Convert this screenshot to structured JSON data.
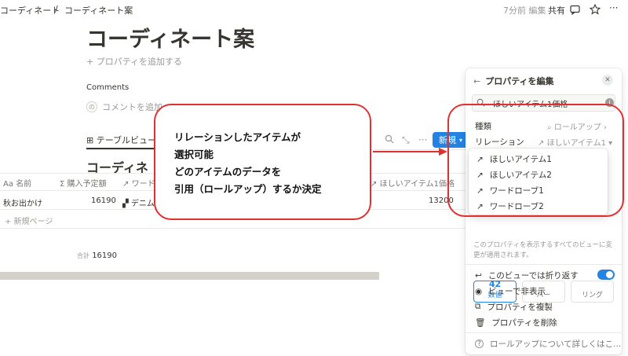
{
  "breadcrumb": {
    "parent": "コーディネート",
    "separator": "/",
    "current": "コーディネート案"
  },
  "topbar": {
    "edited": "7分前 編集",
    "share": "共有"
  },
  "page": {
    "title": "コーディネート案",
    "add_property": "+ プロパティを追加する"
  },
  "comments": {
    "heading": "Comments",
    "avatar": "の",
    "placeholder": "コメントを追加"
  },
  "database": {
    "view_tab": "テーブルビュー",
    "title": "コーディネ",
    "new_button": "新規",
    "columns": [
      "名前",
      "購入予定額",
      "ワード",
      "ほしいアイテム1価格"
    ],
    "column_prefixes": [
      "Aa",
      "Σ",
      "↗",
      "↗"
    ],
    "row": {
      "name": "秋お出かけ",
      "amount": "16190",
      "relation": "デニム",
      "price": "13200"
    },
    "new_page": "+ 新規ページ",
    "total_label": "合計",
    "total_value": "16190"
  },
  "callout": {
    "lines": [
      "リレーションしたアイテムが",
      "選択可能",
      "どのアイテムのデータを",
      "引用（ロールアップ）するか決定"
    ]
  },
  "panel": {
    "title": "プロパティを編集",
    "name_value": "ほしいアイテム1価格",
    "type_label": "種類",
    "type_value": "ロールアップ",
    "relation_label": "リレーション",
    "relation_value": "ほしいアイテム1",
    "dropdown": [
      "ほしいアイテム1",
      "ほしいアイテム2",
      "ワードローブ1",
      "ワードローブ2"
    ],
    "formats": [
      {
        "value": "42",
        "label": "数値"
      },
      {
        "value": "",
        "label": "バー"
      },
      {
        "value": "",
        "label": "リング"
      }
    ],
    "description": "このプロパティを表示するすべてのビューに変更が適用されます。",
    "options": [
      "このビューでは折り返す",
      "ビューで非表示",
      "プロパティを複製",
      "プロパティを削除"
    ],
    "help": "ロールアップについて詳しくはこ..."
  },
  "colors": {
    "accent": "#2383e2",
    "highlight_red": "#e03131",
    "text": "#37352f"
  }
}
